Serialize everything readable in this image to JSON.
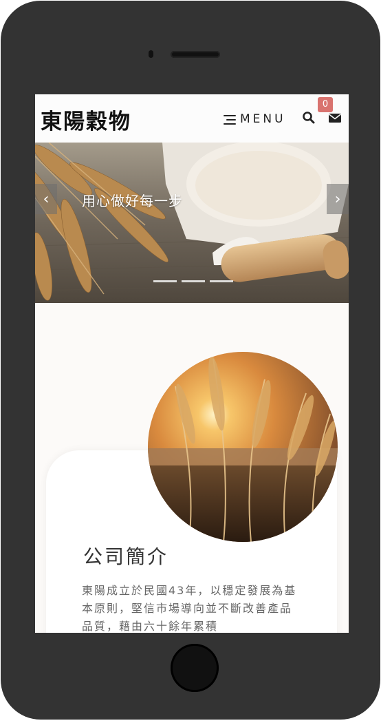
{
  "header": {
    "logo_text": "東陽穀物",
    "menu_label": "MENU",
    "cart_count": "0",
    "icons": [
      "menu-icon",
      "search-icon",
      "mail-icon"
    ]
  },
  "hero": {
    "caption": "用心做好每一步",
    "prev_arrow": "‹",
    "next_arrow": "›",
    "slide_count": 3
  },
  "about": {
    "title": "公司簡介",
    "text": "東陽成立於民國43年，以穩定發展為基本原則，堅信市場導向並不斷改善產品品質，藉由六十餘年累積"
  },
  "colors": {
    "badge": "#d9736f",
    "frame": "#333333",
    "background": "#fcfaf8"
  }
}
